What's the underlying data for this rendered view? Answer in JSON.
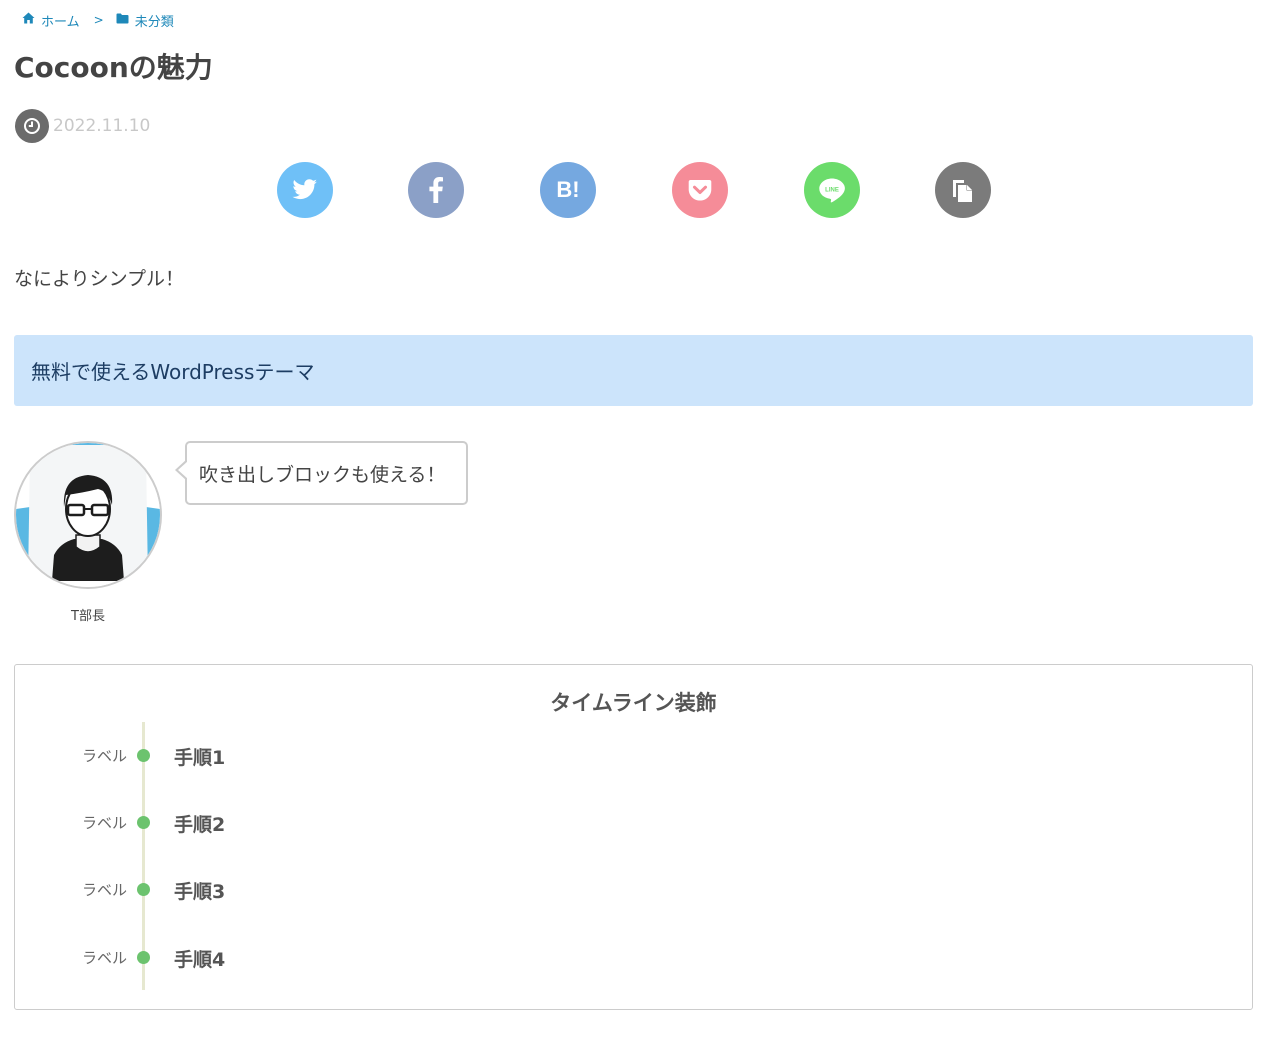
{
  "breadcrumb": {
    "home": "ホーム",
    "separator": ">",
    "category": "未分類"
  },
  "post": {
    "title": "Cocoonの魅力",
    "date": "2022.11.10",
    "lead": "なによりシンプル！"
  },
  "share": {
    "buttons": [
      {
        "name": "twitter",
        "icon": "twitter-bird-icon",
        "color": "#6fc0f7"
      },
      {
        "name": "facebook",
        "icon": "facebook-f-icon",
        "color": "#8ba0c7"
      },
      {
        "name": "hatena",
        "icon": "hatena-bookmark-icon",
        "color": "#75a8e0",
        "label": "B!"
      },
      {
        "name": "pocket",
        "icon": "pocket-icon",
        "color": "#f58c98"
      },
      {
        "name": "line",
        "icon": "line-icon",
        "color": "#6bdc6b",
        "label": "LINE"
      },
      {
        "name": "copy",
        "icon": "copy-document-icon",
        "color": "#7b7b7b"
      }
    ]
  },
  "info_box": {
    "text": "無料で使えるWordPressテーマ",
    "color": "#cce4fb"
  },
  "speech": {
    "avatar_name": "T部長",
    "text": "吹き出しブロックも使える！"
  },
  "timeline": {
    "title": "タイムライン装飾",
    "accent": "#6cc36e",
    "items": [
      {
        "label": "ラベル",
        "step": "手順1"
      },
      {
        "label": "ラベル",
        "step": "手順2"
      },
      {
        "label": "ラベル",
        "step": "手順3"
      },
      {
        "label": "ラベル",
        "step": "手順4"
      }
    ]
  }
}
